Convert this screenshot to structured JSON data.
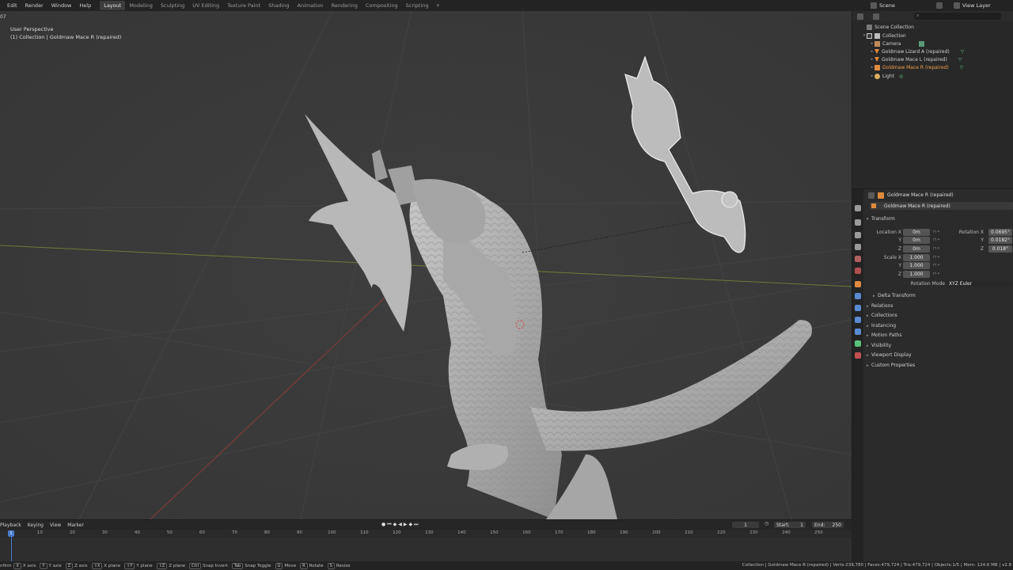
{
  "top_menu": [
    "Edit",
    "Render",
    "Window",
    "Help"
  ],
  "workspaces": [
    "Layout",
    "Modeling",
    "Sculpting",
    "UV Editing",
    "Texture Paint",
    "Shading",
    "Animation",
    "Rendering",
    "Compositing",
    "Scripting"
  ],
  "workspace_add": "+",
  "scene": "Scene",
  "view_layer": "View Layer",
  "viewport": {
    "frame_num": "07",
    "perspective": "User Perspective",
    "collection_info": "(1) Collection | Goldmaw Mace R (repaired)"
  },
  "outliner": {
    "root": "Scene Collection",
    "collection": "Collection",
    "items": [
      {
        "name": "Camera",
        "selected": false
      },
      {
        "name": "Goldmaw Lizard A (repaired)",
        "selected": false
      },
      {
        "name": "Goldmaw Mace L (repaired)",
        "selected": false
      },
      {
        "name": "Goldmaw Mace R (repaired)",
        "selected": true
      },
      {
        "name": "Light",
        "selected": false
      }
    ]
  },
  "properties": {
    "header_name": "Goldmaw Mace R (repaired)",
    "object_name": "Goldmaw Mace R (repaired)",
    "transform_label": "Transform",
    "location_label": "Location X",
    "loc": [
      "0m",
      "0m",
      "0m"
    ],
    "rotation_label": "Rotation X",
    "rot": [
      "0.0695°",
      "0.0182°",
      "0.018°"
    ],
    "scale_label": "Scale X",
    "scale": [
      "1.000",
      "1.000",
      "1.000"
    ],
    "y_label": "Y",
    "z_label": "Z",
    "rotation_mode_label": "Rotation Mode",
    "rotation_mode": "XYZ Euler",
    "delta_transform": "Delta Transform",
    "panels": [
      "Relations",
      "Collections",
      "Instancing",
      "Motion Paths",
      "Visibility",
      "Viewport Display",
      "Custom Properties"
    ]
  },
  "timeline": {
    "menus": [
      "Playback",
      "Keying",
      "View",
      "Marker"
    ],
    "current_frame": "1",
    "start_label": "Start:",
    "start": "1",
    "end_label": "End:",
    "end": "250",
    "playhead": "1",
    "ticks": [
      "10",
      "20",
      "30",
      "40",
      "50",
      "60",
      "70",
      "80",
      "90",
      "100",
      "110",
      "120",
      "130",
      "140",
      "150",
      "160",
      "170",
      "180",
      "190",
      "200",
      "210",
      "220",
      "230",
      "240",
      "250"
    ]
  },
  "statusbar": {
    "hints": [
      {
        "key": "X",
        "label": "X axis"
      },
      {
        "key": "Y",
        "label": "Y axis"
      },
      {
        "key": "Z",
        "label": "Z axis"
      },
      {
        "key": "⇧X",
        "label": "X plane"
      },
      {
        "key": "⇧Y",
        "label": "Y plane"
      },
      {
        "key": "⇧Z",
        "label": "Z plane"
      },
      {
        "key": "Ctrl",
        "label": "Snap Invert"
      },
      {
        "key": "Tab",
        "label": "Snap Toggle"
      },
      {
        "key": "G",
        "label": "Move"
      },
      {
        "key": "R",
        "label": "Rotate"
      },
      {
        "key": "S",
        "label": "Resize"
      }
    ],
    "first_word": "nfirm",
    "stats": "Collection | Goldmaw Mace R (repaired) | Verts:239,780 | Faces:479,724 | Tris:479,724 | Objects:1/5 | Mem: 124.6 MB | v2.8"
  },
  "colors": {
    "accent": "#4a7ccf",
    "selected_text": "#f0a050",
    "mesh_color": "#b4b4b4"
  }
}
